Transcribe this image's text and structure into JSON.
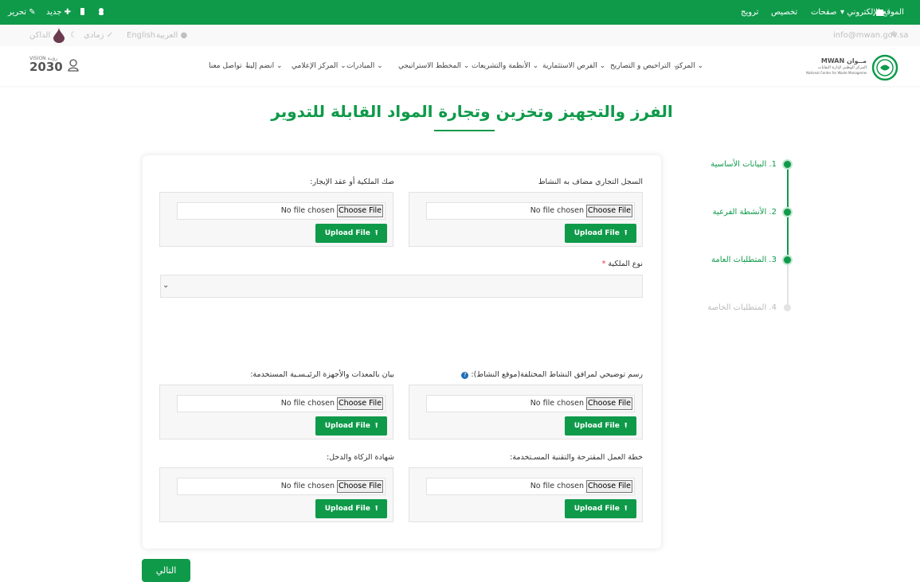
{
  "admin_bar": {
    "site_label": "الموقع الإلكتروني",
    "pages_label": "صفحات",
    "customize_label": "تخصيص",
    "promote_label": "ترويج",
    "edit_label": "تحرير",
    "new_label": "جديد"
  },
  "util_bar": {
    "email": "info@mwan.gov.sa",
    "arabic_label": "العربية",
    "english_label": "English",
    "emerald_label": "زمادى",
    "dark_label": "الداكن"
  },
  "header": {
    "logo_right_name": "MWAN",
    "logo_right_arabic": "مــوان",
    "logo_right_sub": "المركز الوطني لإدارة النفايات",
    "logo_right_en": "National Center for Waste Management",
    "logo_left_vision": "VISION رؤيـة",
    "logo_left_year": "2030",
    "nav": [
      "المركز",
      "التراخيص و التصاريح",
      "الفرص الاستثمارية",
      "الأنظمة والتشريعات",
      "المخطط الاستراتيجي",
      "المبادرات",
      "المركز الإعلامي",
      "انضم إلينا",
      "تواصل معنا"
    ]
  },
  "page": {
    "title": "الفرز والتجهيز وتخزين وتجارة المواد القابلة للتدوير",
    "next_label": "التالي"
  },
  "steps": [
    "1. البيانات الأساسية",
    "2. الأنشطة الفرعية",
    "3. المتطلبات العامة",
    "4. المتطلبات الخاصة"
  ],
  "form": {
    "no_file_text": "No file chosen",
    "choose_label": "Choose File",
    "upload_label": "Upload File",
    "commercial_register_label": "السجل التجاري مضاف به النشاط",
    "ownership_deed_label": "صك الملكية أو عقد الإيجار:",
    "ownership_type_label": "نوع الملكية",
    "required_mark": "*",
    "site_diagram_label": "رسم توضيحي لمرافق النشاط المختلفة(موقع النشاط):",
    "equipment_list_label": "بيان بالمعدات والأجهزة الرئيـسـية المستخدمة:",
    "work_plan_label": "خطة العمل المقترحة والتقنية المسـتخدمة:",
    "zakat_label": "شهادة الزكاة والدخل:"
  },
  "colors": {
    "brand": "#0f9a4a",
    "inactive_step": "#d9d9d9"
  }
}
